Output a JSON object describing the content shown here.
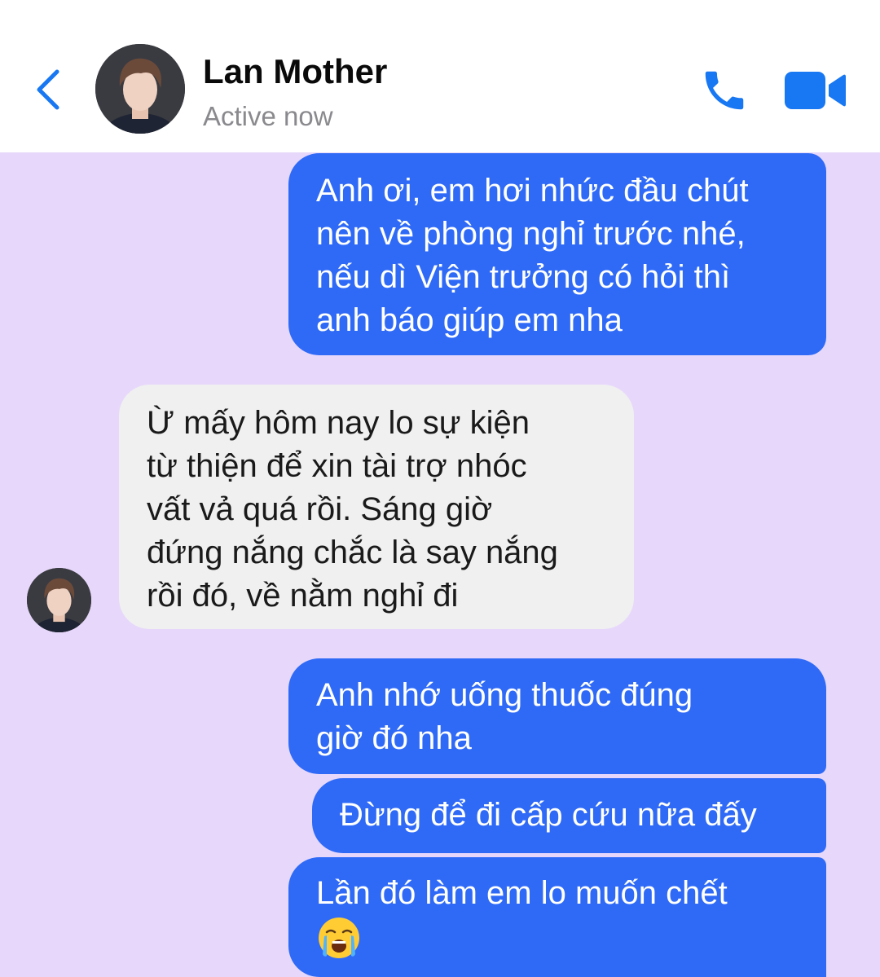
{
  "header": {
    "contact_name": "Lan Mother",
    "status": "Active now",
    "icons": {
      "back": "chevron-left-icon",
      "call": "phone-icon",
      "video": "video-camera-icon"
    }
  },
  "colors": {
    "accent": "#1877f2",
    "outgoing_bubble": "#2f6af7",
    "incoming_bubble": "#f0f0f0",
    "chat_background": "#e7d8fb"
  },
  "messages": [
    {
      "direction": "outgoing",
      "lines": [
        "Anh ơi, em hơi nhức đầu chút",
        "nên về phòng nghỉ trước nhé,",
        "nếu dì Viện trưởng có hỏi thì",
        "anh báo giúp em nha"
      ]
    },
    {
      "direction": "incoming",
      "lines": [
        "Ừ mấy hôm nay lo sự kiện",
        "từ thiện để xin tài trợ nhóc",
        "vất vả quá rồi. Sáng giờ",
        "đứng nắng chắc là say nắng",
        "rồi đó, về nằm nghỉ đi"
      ]
    },
    {
      "direction": "outgoing",
      "lines": [
        "Anh nhớ uống thuốc đúng",
        "giờ đó nha"
      ]
    },
    {
      "direction": "outgoing",
      "lines": [
        "Đừng để đi cấp cứu nữa đấy"
      ]
    },
    {
      "direction": "outgoing",
      "lines": [
        "Lần đó làm em lo muốn chết"
      ],
      "emoji": "crying-face-emoji"
    }
  ]
}
